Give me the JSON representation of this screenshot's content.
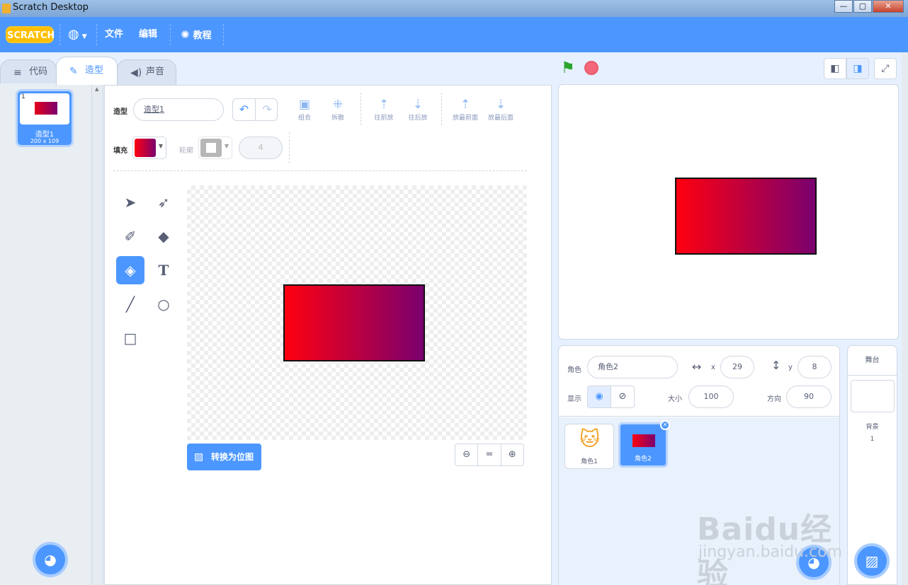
{
  "window": {
    "title": "Scratch Desktop",
    "minimize": "—",
    "maximize": "▢",
    "close": "✕"
  },
  "menubar": {
    "logo": "SCRATCH",
    "language_icon": "globe-icon",
    "file": "文件",
    "edit": "编辑",
    "tutorials": "教程"
  },
  "tabs": [
    {
      "label": "代码"
    },
    {
      "label": "造型"
    },
    {
      "label": "声音"
    }
  ],
  "costumes": [
    {
      "index": "1",
      "name": "造型1",
      "size": "200 x 109"
    }
  ],
  "editor": {
    "costume_label": "造型",
    "costume_name": "造型1",
    "fill_label": "填充",
    "outline_label": "轮廓",
    "outline_width": "4",
    "toolbar": {
      "group": "组合",
      "ungroup": "拆散",
      "forward": "往前放",
      "backward": "往后放",
      "front": "放最前面",
      "back": "放最后面"
    },
    "convert_label": "转换为位图",
    "colors": {
      "fill_start": "#ff0010",
      "fill_end": "#7a006e",
      "accent": "#4c97ff"
    }
  },
  "sprite_info": {
    "sprite_label": "角色",
    "sprite_name": "角色2",
    "x_label": "x",
    "x": "29",
    "y_label": "y",
    "y": "8",
    "show_label": "显示",
    "size_label": "大小",
    "size": "100",
    "direction_label": "方向",
    "direction": "90"
  },
  "sprites": [
    {
      "name": "角色1"
    },
    {
      "name": "角色2"
    }
  ],
  "stage_pane": {
    "header": "舞台",
    "backdrops_label": "背景",
    "backdrops_count": "1"
  },
  "watermark": {
    "brand": "Baidu经验",
    "url": "jingyan.baidu.com"
  }
}
